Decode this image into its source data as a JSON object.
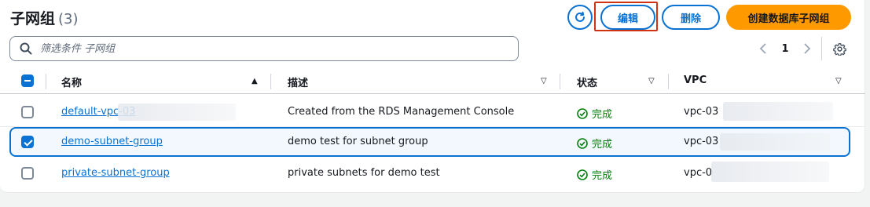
{
  "header": {
    "title": "子网组",
    "count": "(3)"
  },
  "toolbar": {
    "edit_label": "编辑",
    "delete_label": "删除",
    "create_label": "创建数据库子网组"
  },
  "search": {
    "placeholder": "筛选条件 子网组"
  },
  "pagination": {
    "current_page": "1"
  },
  "columns": {
    "name": "名称",
    "description": "描述",
    "status": "状态",
    "vpc": "VPC"
  },
  "rows": [
    {
      "name": "default-vpc-03",
      "description": "Created from the RDS Management Console",
      "status": "完成",
      "vpc": "vpc-03",
      "selected": false
    },
    {
      "name": "demo-subnet-group",
      "description": "demo test for subnet group",
      "status": "完成",
      "vpc": "vpc-03",
      "selected": true
    },
    {
      "name": "private-subnet-group",
      "description": "private subnets for demo test",
      "status": "完成",
      "vpc": "vpc-0",
      "selected": false
    }
  ],
  "colors": {
    "accent": "#0972d3",
    "primary_button": "#ff9900",
    "success": "#037f0c",
    "highlight": "#d13212"
  }
}
